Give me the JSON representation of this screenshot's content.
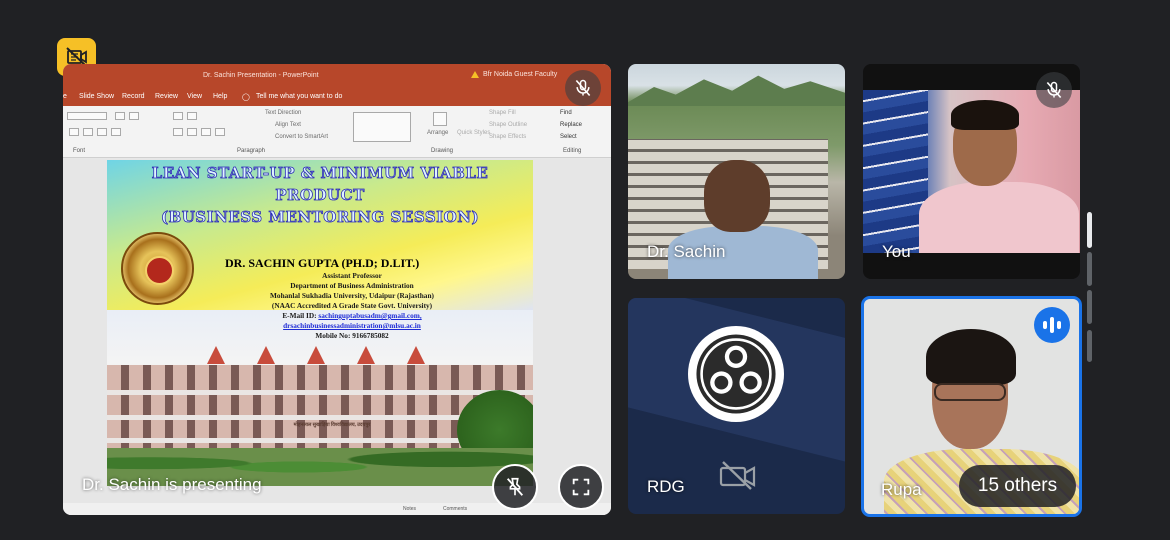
{
  "presentation": {
    "app_title": "Dr. Sachin Presentation - PowerPoint",
    "account_warning": "Bfr Noida Guest Faculty",
    "ribbon_tabs": [
      "e",
      "Slide Show",
      "Record",
      "Review",
      "View",
      "Help"
    ],
    "tell_me": "Tell me what you want to do",
    "ribbon_items": {
      "text_direction": "Text Direction",
      "align_text": "Align Text",
      "smartart": "Convert to SmartArt",
      "arrange": "Arrange",
      "quick_styles": "Quick Styles",
      "shape_fill": "Shape Fill",
      "shape_outline": "Shape Outline",
      "shape_effects": "Shape Effects",
      "find": "Find",
      "replace": "Replace",
      "select": "Select"
    },
    "groups": [
      "Font",
      "Paragraph",
      "Drawing",
      "Editing"
    ],
    "status": {
      "notes": "Notes",
      "comments": "Comments"
    },
    "slide": {
      "title_1": "LEAN START-UP & MINIMUM VIABLE",
      "title_2": "PRODUCT",
      "title_3": "(BUSINESS MENTORING SESSION)",
      "name": "DR. SACHIN GUPTA (PH.D; D.LIT.)",
      "designation": "Assistant Professor",
      "department": "Department of Business Administration",
      "university": "Mohanlal Sukhadia University, Udaipur (Rajasthan)",
      "accreditation": "(NAAC Accredited A Grade State Govt. University)",
      "email_label": "E-Mail ID: ",
      "email_1": "sachinguptabusadm@gmail.com,",
      "email_2": "drsachinbusinessadministration@mlsu.ac.in",
      "mobile": "Mobile No: 9166785082",
      "building_sign": "मोहनलाल सुखाड़िया विश्वविद्यालय, उदयपुर"
    }
  },
  "meeting": {
    "presenting_label": "Dr. Sachin is presenting",
    "participants": [
      {
        "name": "Dr. Sachin"
      },
      {
        "name": "You"
      },
      {
        "name": "RDG"
      },
      {
        "name": "Rupa"
      }
    ],
    "others_count_label": "15 others"
  },
  "colors": {
    "background": "#202124",
    "badge_yellow": "#f6c026",
    "speaking_blue": "#1a73e8",
    "powerpoint_red": "#b7472a"
  },
  "icons": {
    "no_video_badge": "video-off-icon",
    "pin": "unpin-icon",
    "fullscreen": "fullscreen-icon",
    "mic_muted": "mic-off-icon",
    "camera_off": "camera-off-icon",
    "speaking": "audio-wave-icon"
  }
}
